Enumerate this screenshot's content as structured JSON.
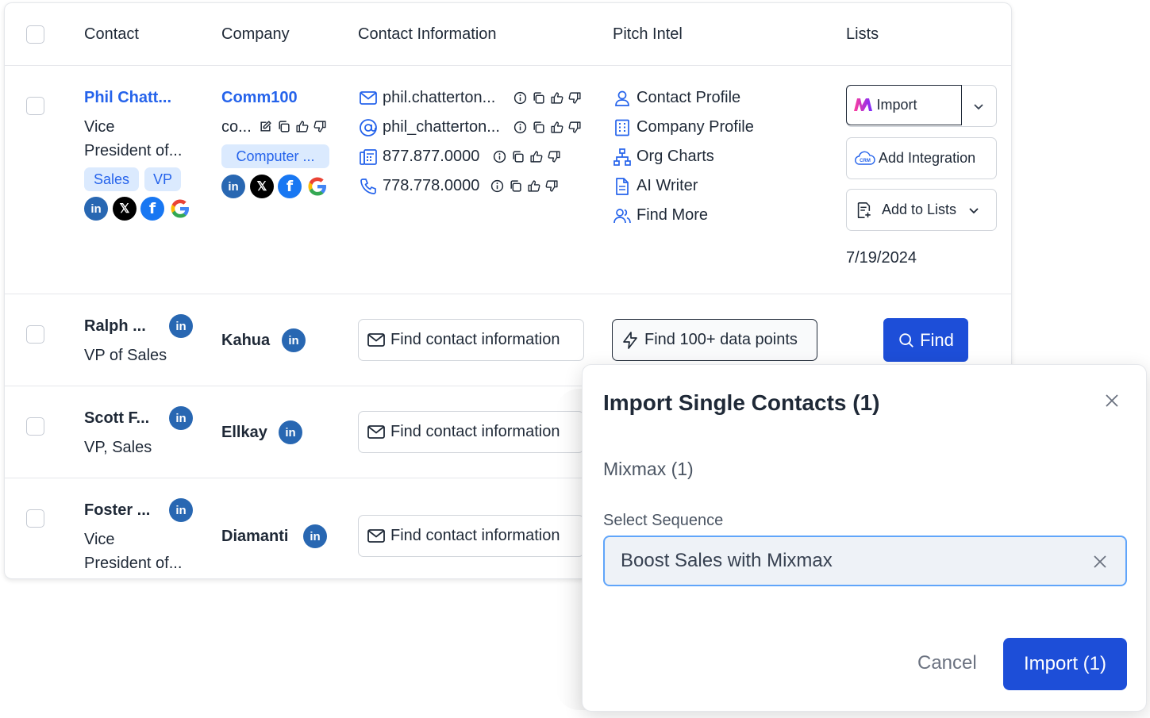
{
  "table": {
    "headers": [
      "Contact",
      "Company",
      "Contact Information",
      "Pitch Intel",
      "Lists"
    ],
    "row1": {
      "name": "Phil Chatt...",
      "title_line1": "Vice",
      "title_line2": "President of...",
      "tags": [
        "Sales",
        "VP"
      ],
      "company": "Comm100",
      "company_sub": "co...",
      "company_tag": "Computer ...",
      "email": "phil.chatterton...",
      "handle": "phil_chatterton...",
      "fax": "877.877.0000",
      "phone": "778.778.0000",
      "pitch_intel": [
        "Contact Profile",
        "Company Profile",
        "Org Charts",
        "AI Writer",
        "Find More"
      ],
      "import_label": "Import",
      "add_integration_label": "Add Integration",
      "add_to_lists_label": "Add to Lists",
      "date": "7/19/2024"
    },
    "row2": {
      "name": "Ralph ...",
      "title": "VP of Sales",
      "company": "Kahua",
      "find_contact_label": "Find contact information",
      "find_data_label": "Find 100+ data points",
      "find_label": "Find"
    },
    "row3": {
      "name": "Scott F...",
      "title": "VP, Sales",
      "company": "Ellkay",
      "find_contact_label": "Find contact information"
    },
    "row4": {
      "name": "Foster ...",
      "title_line1": "Vice",
      "title_line2": "President of...",
      "company": "Diamanti",
      "find_contact_label": "Find contact information"
    },
    "social": {
      "linkedin": "in",
      "x": "𝕏",
      "facebook": "f",
      "google": "G"
    }
  },
  "modal": {
    "title": "Import Single Contacts (1)",
    "section": "Mixmax (1)",
    "select_label": "Select Sequence",
    "select_value": "Boost Sales with Mixmax",
    "cancel_label": "Cancel",
    "import_label": "Import (1)"
  },
  "colors": {
    "brand_blue": "#2563eb",
    "primary_button": "#1d4ed8",
    "tag_bg": "#dbeafe",
    "linkedin": "#2867b2"
  }
}
